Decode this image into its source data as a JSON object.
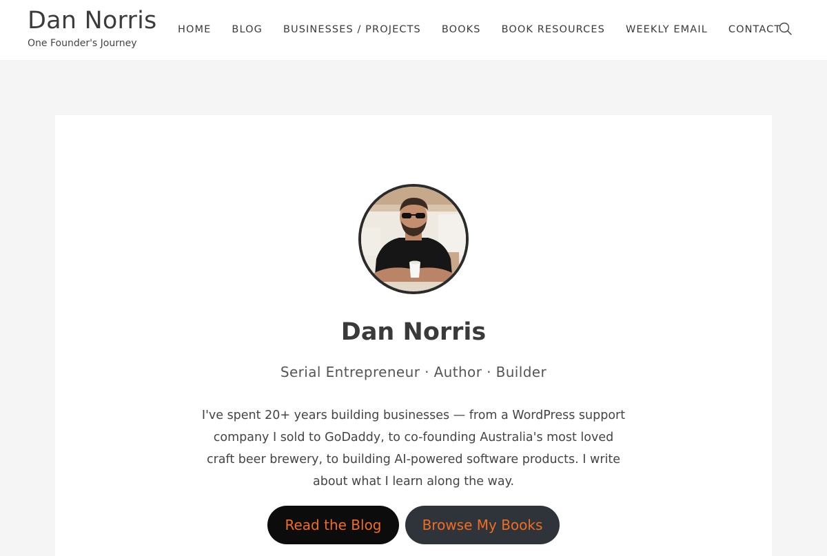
{
  "header": {
    "site_title": "Dan Norris",
    "tagline": "One Founder's Journey",
    "nav": [
      {
        "label": "HOME"
      },
      {
        "label": "BLOG"
      },
      {
        "label": "BUSINESSES / PROJECTS"
      },
      {
        "label": "BOOKS"
      },
      {
        "label": "BOOK RESOURCES"
      },
      {
        "label": "WEEKLY EMAIL"
      },
      {
        "label": "CONTACT"
      }
    ],
    "search_icon": "search-icon"
  },
  "hero": {
    "name": "Dan Norris",
    "roles": "Serial Entrepreneur · Author · Builder",
    "bio": "I've spent 20+ years building businesses — from a WordPress support company I sold to GoDaddy, to co-founding Australia's most loved craft beer brewery, to building AI-powered software products. I write about what I learn along the way.",
    "primary_cta": "Read the Blog",
    "secondary_cta": "Browse My Books"
  },
  "colors": {
    "accent": "#f26d21",
    "primary_button": "#0c0c0c",
    "secondary_button": "#2e3439",
    "page_background": "#f5f5f5",
    "card_background": "#ffffff"
  }
}
